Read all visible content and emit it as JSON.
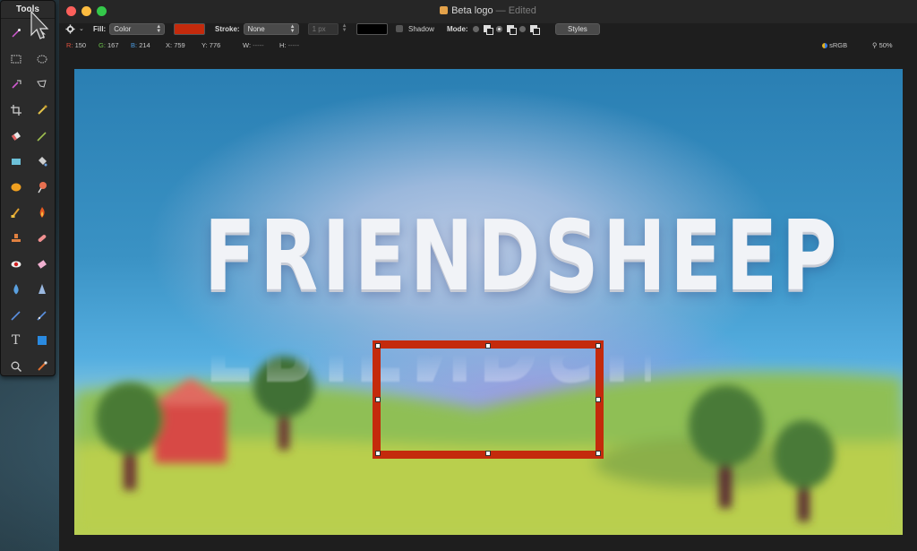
{
  "tools_panel": {
    "title": "Tools",
    "tools": [
      "magic-wand",
      "pointer",
      "rect-select",
      "ellipse-select",
      "lasso",
      "polygon-lasso",
      "crop",
      "eyedropper",
      "eraser",
      "brush",
      "rect-shape",
      "paint-bucket",
      "ellipse-shape",
      "gradient",
      "smudge",
      "burn",
      "stamp",
      "healing",
      "red-eye",
      "pencil-eraser",
      "blur-drop",
      "sharpen-cone",
      "pen",
      "vector-pen",
      "text",
      "shape",
      "zoom",
      "color-picker"
    ]
  },
  "window": {
    "title": "Beta logo",
    "title_suffix": "— Edited"
  },
  "toolbar": {
    "fill_label": "Fill:",
    "fill_value": "Color",
    "fill_color": "#c42a0c",
    "stroke_label": "Stroke:",
    "stroke_value": "None",
    "stroke_width": "1 px",
    "stroke_color": "#000000",
    "shadow_label": "Shadow",
    "mode_label": "Mode:",
    "styles_label": "Styles"
  },
  "infobar": {
    "r_label": "R:",
    "r_value": "150",
    "g_label": "G:",
    "g_value": "167",
    "b_label": "B:",
    "b_value": "214",
    "x_label": "X:",
    "x_value": "759",
    "y_label": "Y:",
    "y_value": "776",
    "w_label": "W:",
    "w_value": "-----",
    "h_label": "H:",
    "h_value": "-----",
    "color_profile": "sRGB",
    "zoom": "50%"
  },
  "canvas": {
    "logo_text": "FRIENDSHEEP",
    "selection_color": "#c42a0c"
  }
}
